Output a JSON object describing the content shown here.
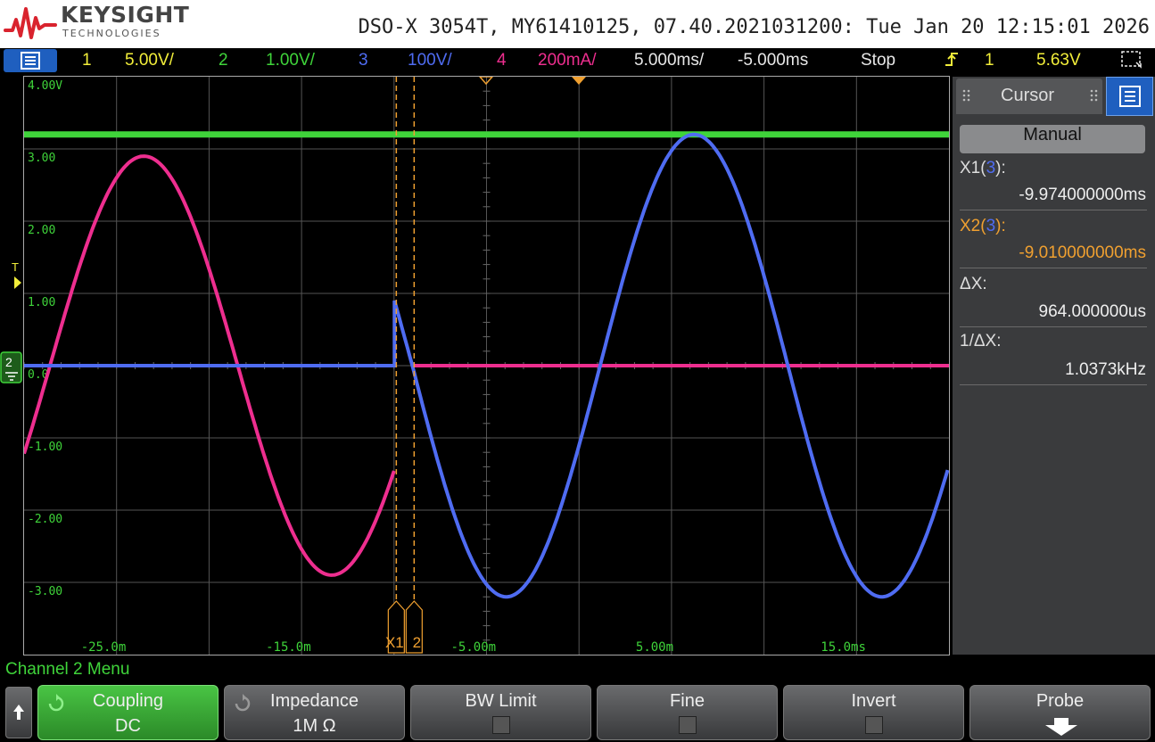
{
  "header": {
    "brand_name": "KEYSIGHT",
    "brand_sub": "TECHNOLOGIES",
    "model_info": "DSO-X 3054T, MY61410125, 07.40.2021031200: Tue Jan 20 12:15:01 2026"
  },
  "statusbar": {
    "ch1_num": "1",
    "ch1_scale": "5.00V/",
    "ch2_num": "2",
    "ch2_scale": "1.00V/",
    "ch3_num": "3",
    "ch3_scale": "100V/",
    "ch4_num": "4",
    "ch4_scale": "200mA/",
    "timebase": "5.000ms/",
    "delay": "-5.000ms",
    "run_state": "Stop",
    "trigger_source": "1",
    "trigger_level": "5.63V"
  },
  "grid": {
    "y_labels": [
      "4.00V",
      "3.00",
      "2.00",
      "1.00",
      "0.0",
      "-1.00",
      "-2.00",
      "-3.00"
    ],
    "x_labels": [
      "-25.0m",
      "-15.0m",
      "-5.00m",
      "5.00m",
      "15.0ms"
    ],
    "trigger_marker_label": "T",
    "ground_marker_label": "2",
    "cursor_x1_label": "X1",
    "cursor_x2_label": "2"
  },
  "cursor_panel": {
    "tab_label": "Cursor",
    "mode": "Manual",
    "x1_label_prefix": "X1(",
    "x1_label_channel": "3",
    "x1_label_suffix": "):",
    "x1_value": "-9.974000000ms",
    "x2_label_prefix": "X2(",
    "x2_label_channel": "3",
    "x2_label_suffix": "):",
    "x2_value": "-9.010000000ms",
    "dx_label": "ΔX:",
    "dx_value": "964.000000us",
    "inv_dx_label": "1/ΔX:",
    "inv_dx_value": "1.0373kHz"
  },
  "softkeys": {
    "menu_title": "Channel 2 Menu",
    "coupling_label": "Coupling",
    "coupling_value": "DC",
    "impedance_label": "Impedance",
    "impedance_value": "1M Ω",
    "bw_limit_label": "BW Limit",
    "fine_label": "Fine",
    "invert_label": "Invert",
    "probe_label": "Probe"
  },
  "colors": {
    "ch1": "#f2ee3a",
    "ch2": "#3fd43a",
    "ch3": "#4f6cf2",
    "ch4": "#ee2e8f",
    "cursor": "#f0a030",
    "brand_red": "#d9232e"
  }
}
